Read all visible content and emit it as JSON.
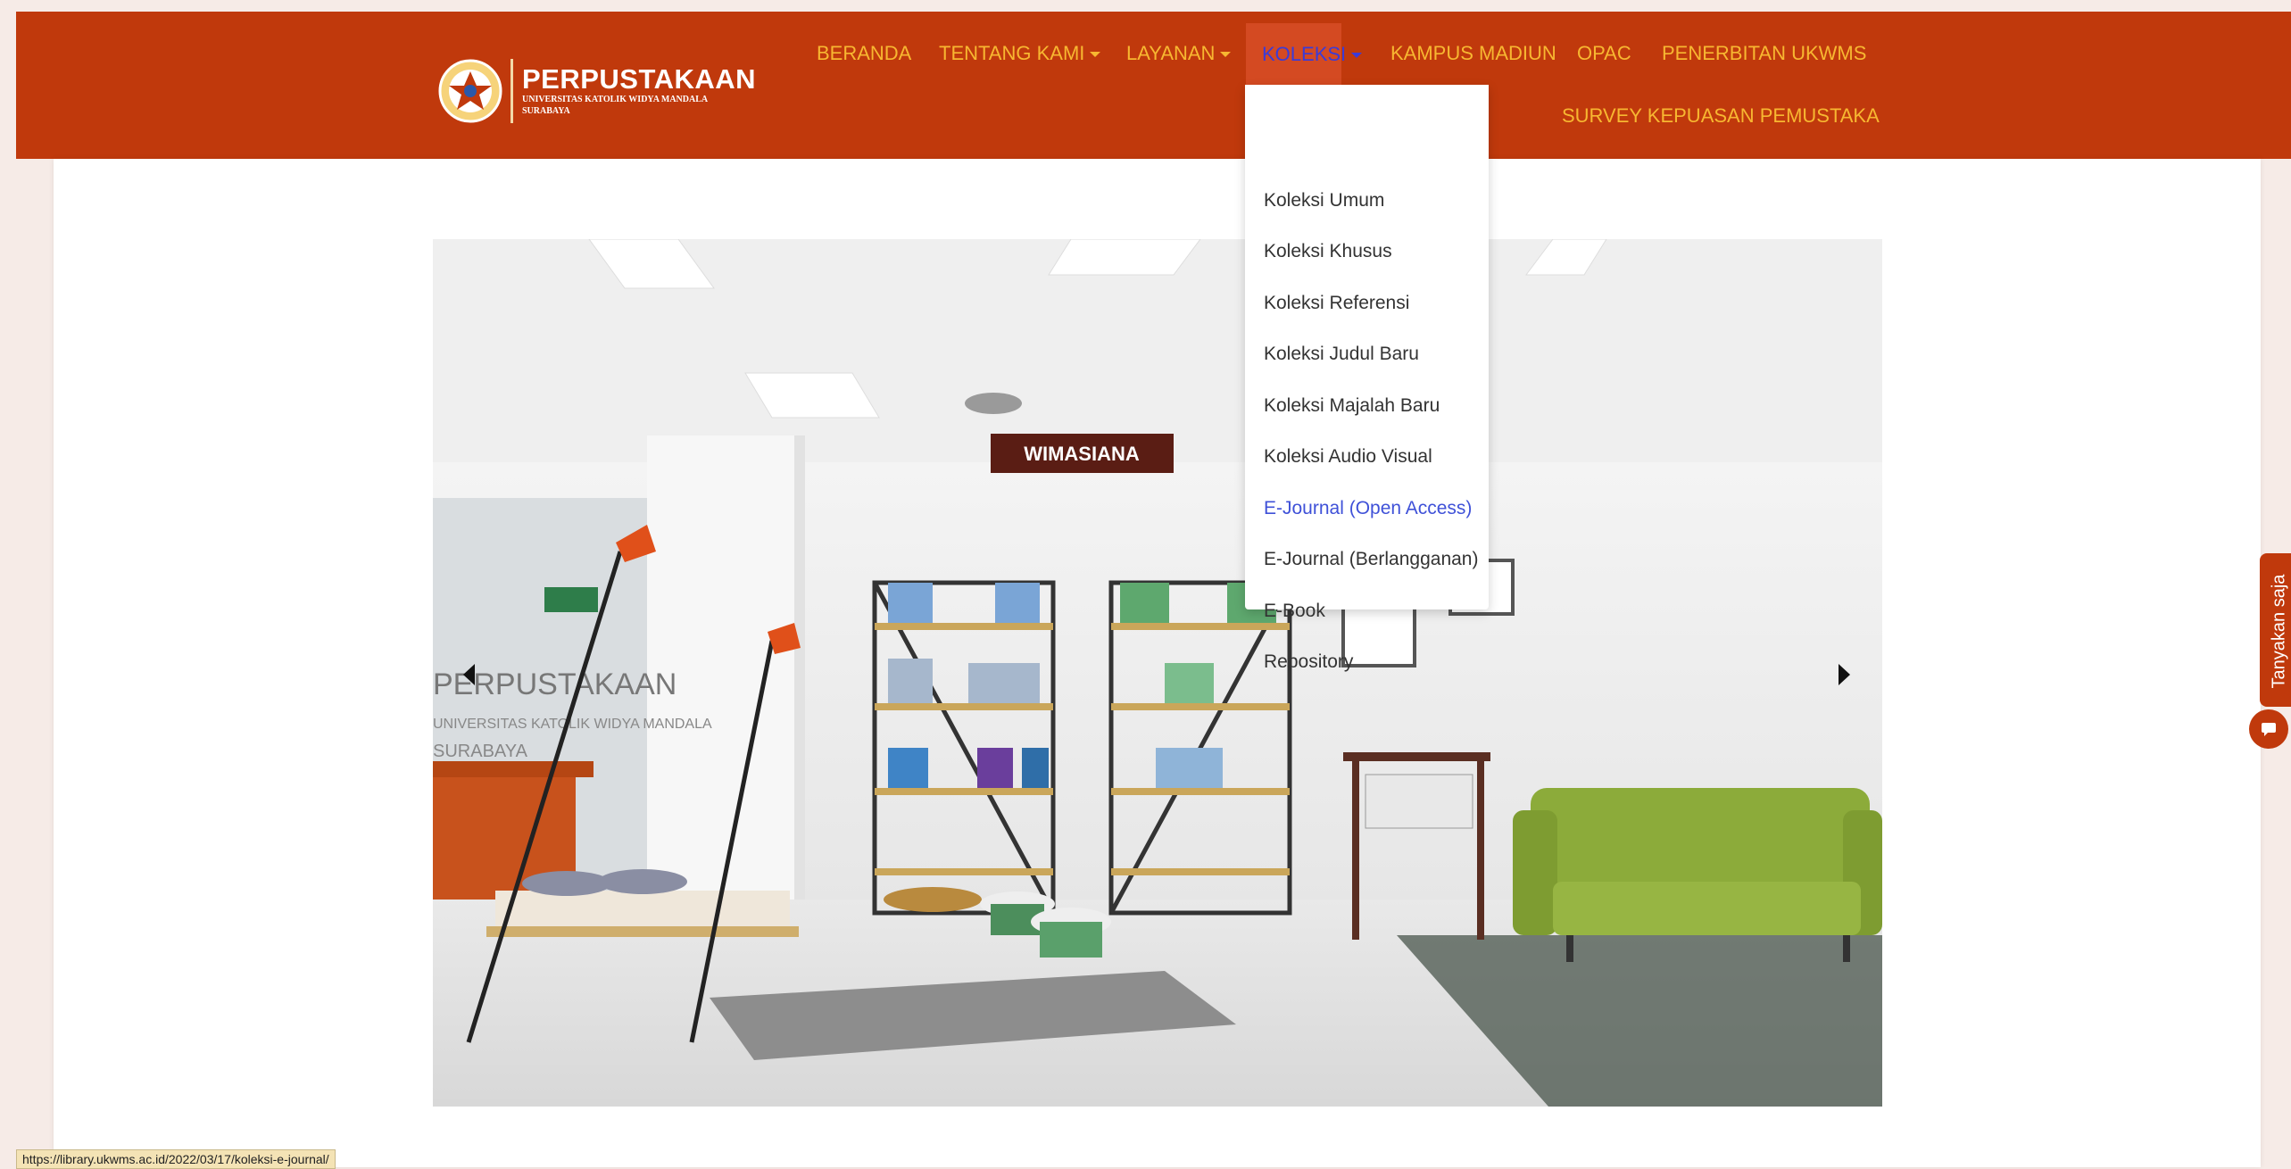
{
  "header": {
    "logo_title": "PERPUSTAKAAN",
    "logo_subtitle": "UNIVERSITAS KATOLIK WIDYA MANDALA SURABAYA",
    "brand_color": "#c0390c",
    "nav_color": "#f7b731"
  },
  "nav": {
    "items": [
      {
        "label": "BERANDA"
      },
      {
        "label": "TENTANG KAMI"
      },
      {
        "label": "LAYANAN"
      },
      {
        "label": "KOLEKSI"
      },
      {
        "label": "KAMPUS MADIUN"
      },
      {
        "label": "OPAC"
      },
      {
        "label": "PENERBITAN UKWMS"
      },
      {
        "label": "SURVEY KEPUASAN PEMUSTAKA"
      }
    ]
  },
  "dropdown": {
    "items": [
      {
        "label": "Koleksi Umum"
      },
      {
        "label": "Koleksi Khusus"
      },
      {
        "label": "Koleksi Referensi"
      },
      {
        "label": "Koleksi Judul Baru"
      },
      {
        "label": "Koleksi Majalah Baru"
      },
      {
        "label": "Koleksi Audio Visual"
      },
      {
        "label": "E-Journal (Open Access)"
      },
      {
        "label": "E-Journal (Berlangganan)"
      },
      {
        "label": "E-Book"
      },
      {
        "label": "Repository"
      }
    ],
    "hover_color": "#3f51d8"
  },
  "carousel": {
    "sign_text": "WIMASIANA",
    "glass_text_1": "PERPUSTAKAAN",
    "glass_text_2": "UNIVERSITAS KATOLIK WIDYA MANDALA",
    "glass_text_3": "SURABAYA"
  },
  "chat": {
    "label": "Tanyakan saja"
  },
  "status": {
    "url": "https://library.ukwms.ac.id/2022/03/17/koleksi-e-journal/"
  }
}
